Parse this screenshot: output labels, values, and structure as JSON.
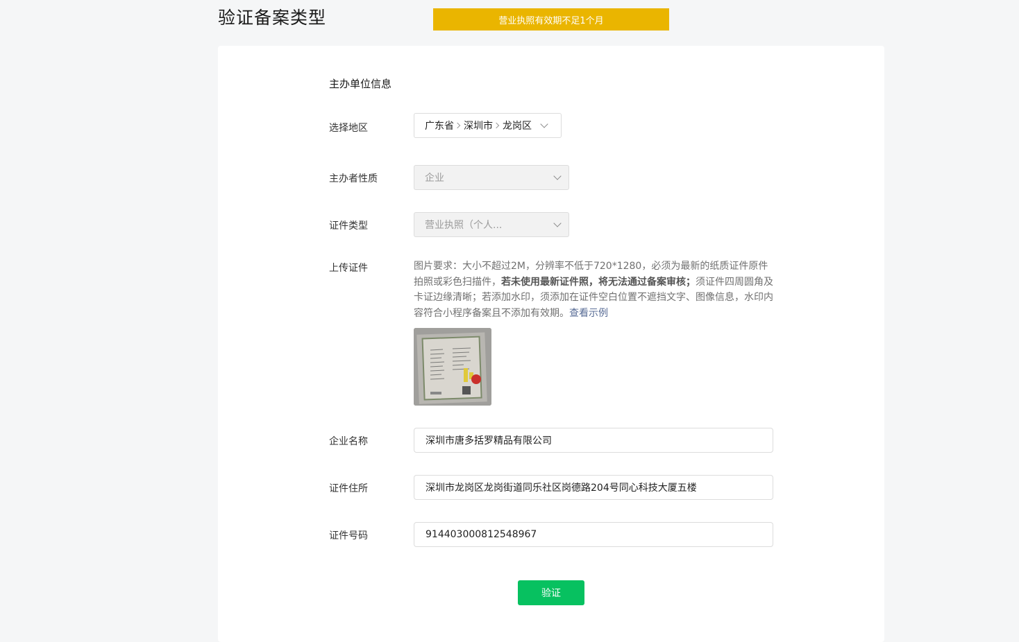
{
  "header": {
    "title": "验证备案类型",
    "banner": "营业执照有效期不足1个月"
  },
  "form": {
    "section_title": "主办单位信息",
    "region": {
      "label": "选择地区",
      "province": "广东省",
      "city": "深圳市",
      "district": "龙岗区"
    },
    "organizer_type": {
      "label": "主办者性质",
      "value": "企业"
    },
    "cert_type": {
      "label": "证件类型",
      "value": "营业执照（个人..."
    },
    "upload": {
      "label": "上传证件",
      "desc_part1": "图片要求：大小不超过2M，分辨率不低于720*1280，必须为最新的纸质证件原件拍照或彩色扫描件，",
      "desc_bold": "若未使用最新证件照，将无法通过备案审核；",
      "desc_part2": "须证件四周圆角及卡证边缘清晰；若添加水印，须添加在证件空白位置不遮挡文字、图像信息，水印内容符合小程序备案且不添加有效期。",
      "example_link": "查看示例"
    },
    "company_name": {
      "label": "企业名称",
      "value": "深圳市唐多括罗精品有限公司"
    },
    "cert_address": {
      "label": "证件住所",
      "value": "深圳市龙岗区龙岗街道同乐社区岗德路204号同心科技大厦五楼"
    },
    "cert_number": {
      "label": "证件号码",
      "value": "914403000812548967"
    },
    "verify_button": "验证"
  },
  "colors": {
    "banner": "#eab500",
    "primary": "#07c160",
    "link": "#576b95"
  }
}
